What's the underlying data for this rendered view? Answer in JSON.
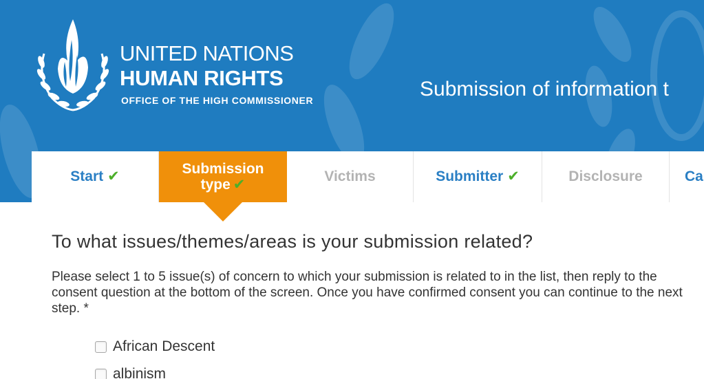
{
  "header": {
    "logo_line1": "UNITED NATIONS",
    "logo_line2": "HUMAN RIGHTS",
    "logo_line3": "OFFICE OF THE HIGH COMMISSIONER",
    "site_title": "Submission of information t",
    "background_color": "#1f7cc0"
  },
  "steps": [
    {
      "label": "Start",
      "state": "done",
      "check": "✔"
    },
    {
      "label": "Submission type",
      "state": "active",
      "check": "✔"
    },
    {
      "label": "Victims",
      "state": "disabled"
    },
    {
      "label": "Submitter",
      "state": "done",
      "check": "✔"
    },
    {
      "label": "Disclosure",
      "state": "disabled"
    },
    {
      "label": "Ca",
      "state": "done"
    }
  ],
  "form": {
    "question": "To what issues/themes/areas is your submission related?",
    "instruction": "Please select 1 to 5 issue(s) of concern to which your submission is related to in the list, then reply to the consent question at the bottom of the screen. Once you have confirmed consent you can continue to the next step. *",
    "options": [
      {
        "label": "African Descent",
        "checked": false
      },
      {
        "label": "albinism",
        "checked": false
      }
    ]
  },
  "colors": {
    "accent_orange": "#f0900a",
    "link_blue": "#2a7fc4",
    "check_green": "#4caf2a"
  }
}
